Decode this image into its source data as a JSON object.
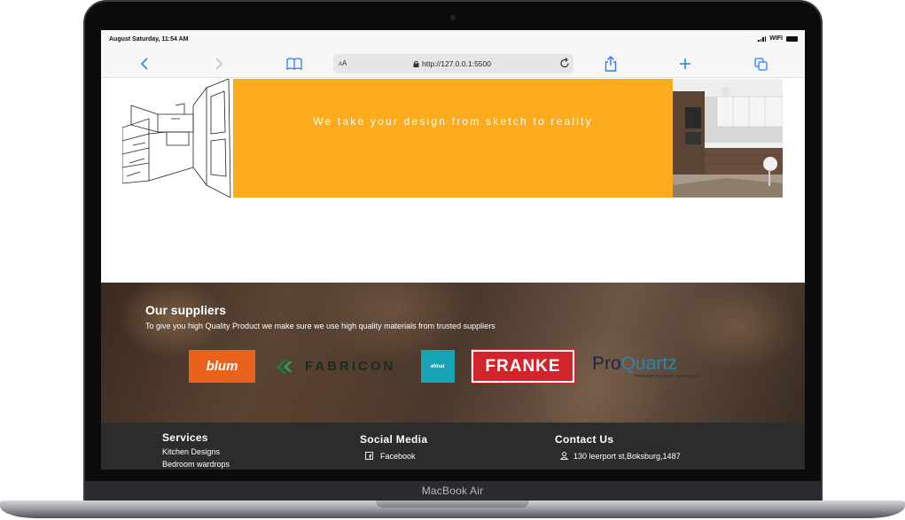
{
  "device": {
    "model_label": "MacBook Air"
  },
  "status_bar": {
    "time": "August Saturday, 11:54 AM",
    "wifi_label": "WIFI"
  },
  "browser": {
    "text_size_label": "AA",
    "url": "http://127.0.0.1:5500",
    "icons": [
      "back-icon",
      "forward-icon",
      "bookmarks-icon",
      "lock-icon",
      "reload-icon",
      "share-icon",
      "new-tab-icon",
      "tabs-icon"
    ]
  },
  "design_banner": {
    "text": "We take your design from sketch to reality",
    "accent_color": "#fbab1c"
  },
  "suppliers": {
    "title": "Our suppliers",
    "subtitle": "To give you high Quality Product we make sure we use high quality materials from trusted suppliers",
    "logos": {
      "blum": "blum",
      "fabricon": "FABRICON",
      "elmar": "elmar",
      "franke": "FRANKE",
      "proquartz_pro": "Pro",
      "proquartz_quartz": "Quartz",
      "proquartz_tagline": "PREMIER QUARTZ SURFACES"
    }
  },
  "footer": {
    "services": {
      "heading": "Services",
      "items": [
        "Kitchen Designs",
        "Bedroom wardrops"
      ]
    },
    "social": {
      "heading": "Social Media",
      "items": [
        "Facebook"
      ]
    },
    "contact": {
      "heading": "Contact Us",
      "address": "130 leerport st,Boksburg,1487"
    }
  }
}
